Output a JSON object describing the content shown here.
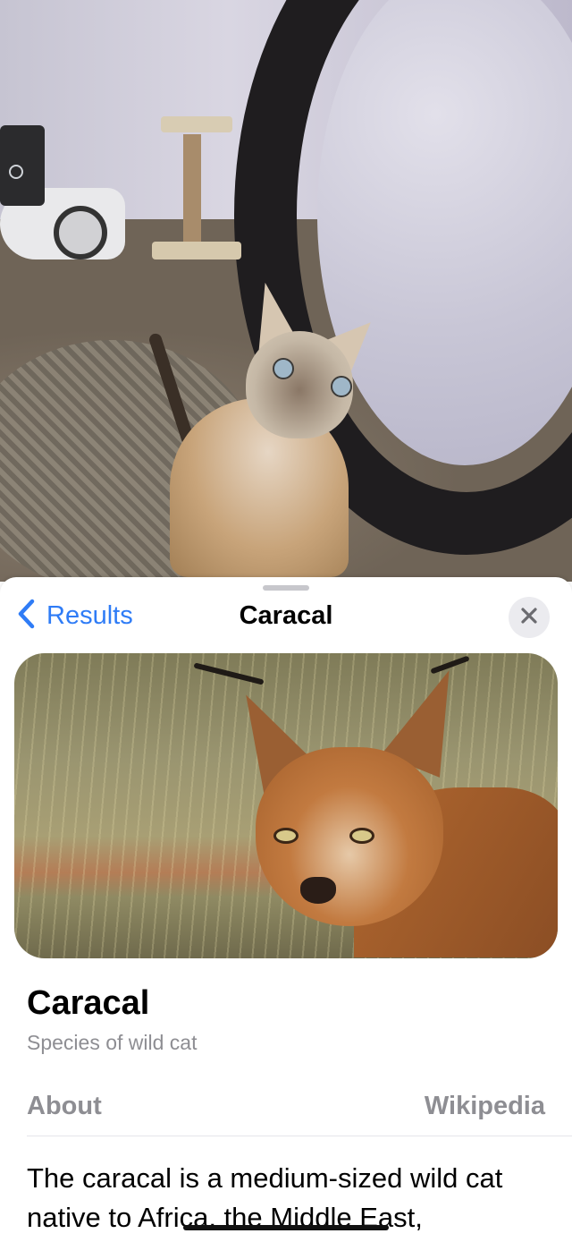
{
  "nav": {
    "back_label": "Results",
    "title": "Caracal"
  },
  "hero": {
    "alt": "Caracal photo"
  },
  "info": {
    "title": "Caracal",
    "subtitle": "Species of wild cat"
  },
  "section": {
    "label": "About",
    "source": "Wikipedia"
  },
  "description": "The caracal is a medium-sized wild cat native to Africa, the Middle East,",
  "colors": {
    "link": "#2f7cf6",
    "secondary_text": "#8e8e93",
    "close_bg": "#ebebef"
  },
  "icons": {
    "back": "chevron-left-icon",
    "close": "xmark-icon"
  }
}
